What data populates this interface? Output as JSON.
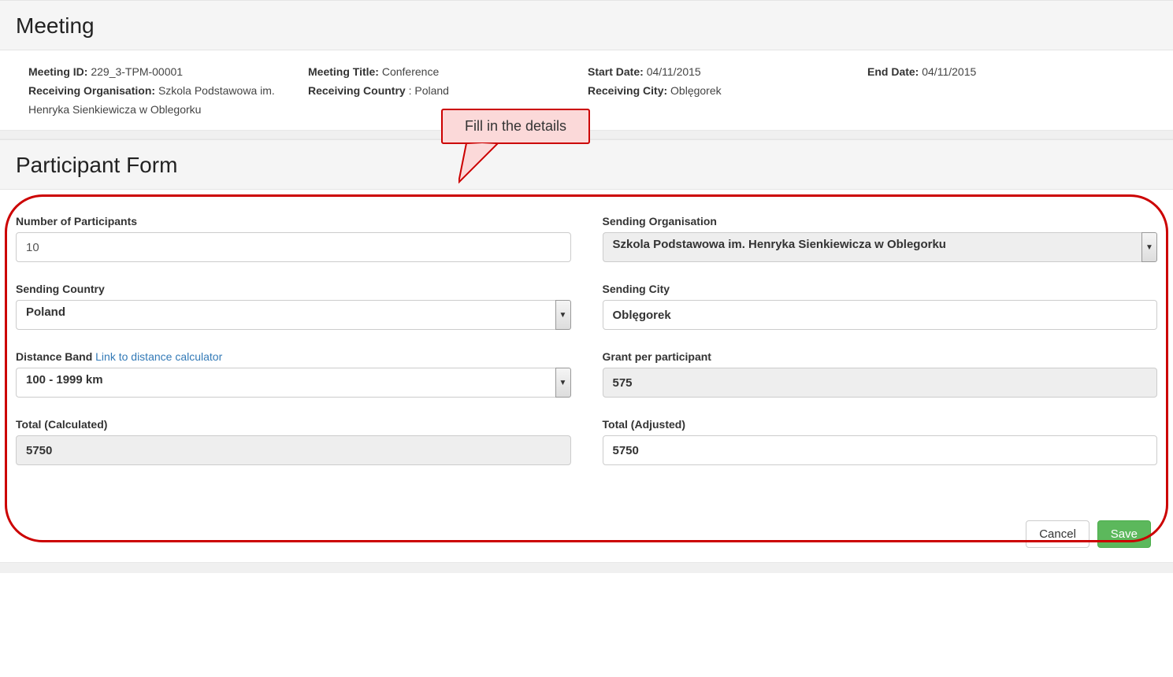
{
  "meeting": {
    "header": "Meeting",
    "idLabel": "Meeting ID:",
    "idValue": "229_3-TPM-00001",
    "orgLabel": "Receiving Organisation:",
    "orgValue": "Szkola Podstawowa im. Henryka Sienkiewicza w Oblegorku",
    "titleLabel": "Meeting Title:",
    "titleValue": "Conference",
    "countryLabel": "Receiving Country",
    "countryValue": ": Poland",
    "startLabel": "Start Date:",
    "startValue": "04/11/2015",
    "cityLabel": "Receiving City:",
    "cityValue": "Oblęgorek",
    "endLabel": "End Date:",
    "endValue": "04/11/2015"
  },
  "participant": {
    "header": "Participant Form",
    "numLabel": "Number of Participants",
    "numValue": "10",
    "sendOrgLabel": "Sending Organisation",
    "sendOrgValue": "Szkola Podstawowa im. Henryka Sienkiewicza w Oblegorku",
    "sendCountryLabel": "Sending Country",
    "sendCountryValue": "Poland",
    "sendCityLabel": "Sending City",
    "sendCityValue": "Oblęgorek",
    "distLabel": "Distance Band",
    "distLinkText": "Link to distance calculator",
    "distValue": "100 - 1999 km",
    "grantLabel": "Grant per participant",
    "grantValue": "575",
    "totalCalcLabel": "Total (Calculated)",
    "totalCalcValue": "5750",
    "totalAdjLabel": "Total (Adjusted)",
    "totalAdjValue": "5750"
  },
  "callout": {
    "text": "Fill in the details"
  },
  "buttons": {
    "cancel": "Cancel",
    "save": "Save"
  }
}
